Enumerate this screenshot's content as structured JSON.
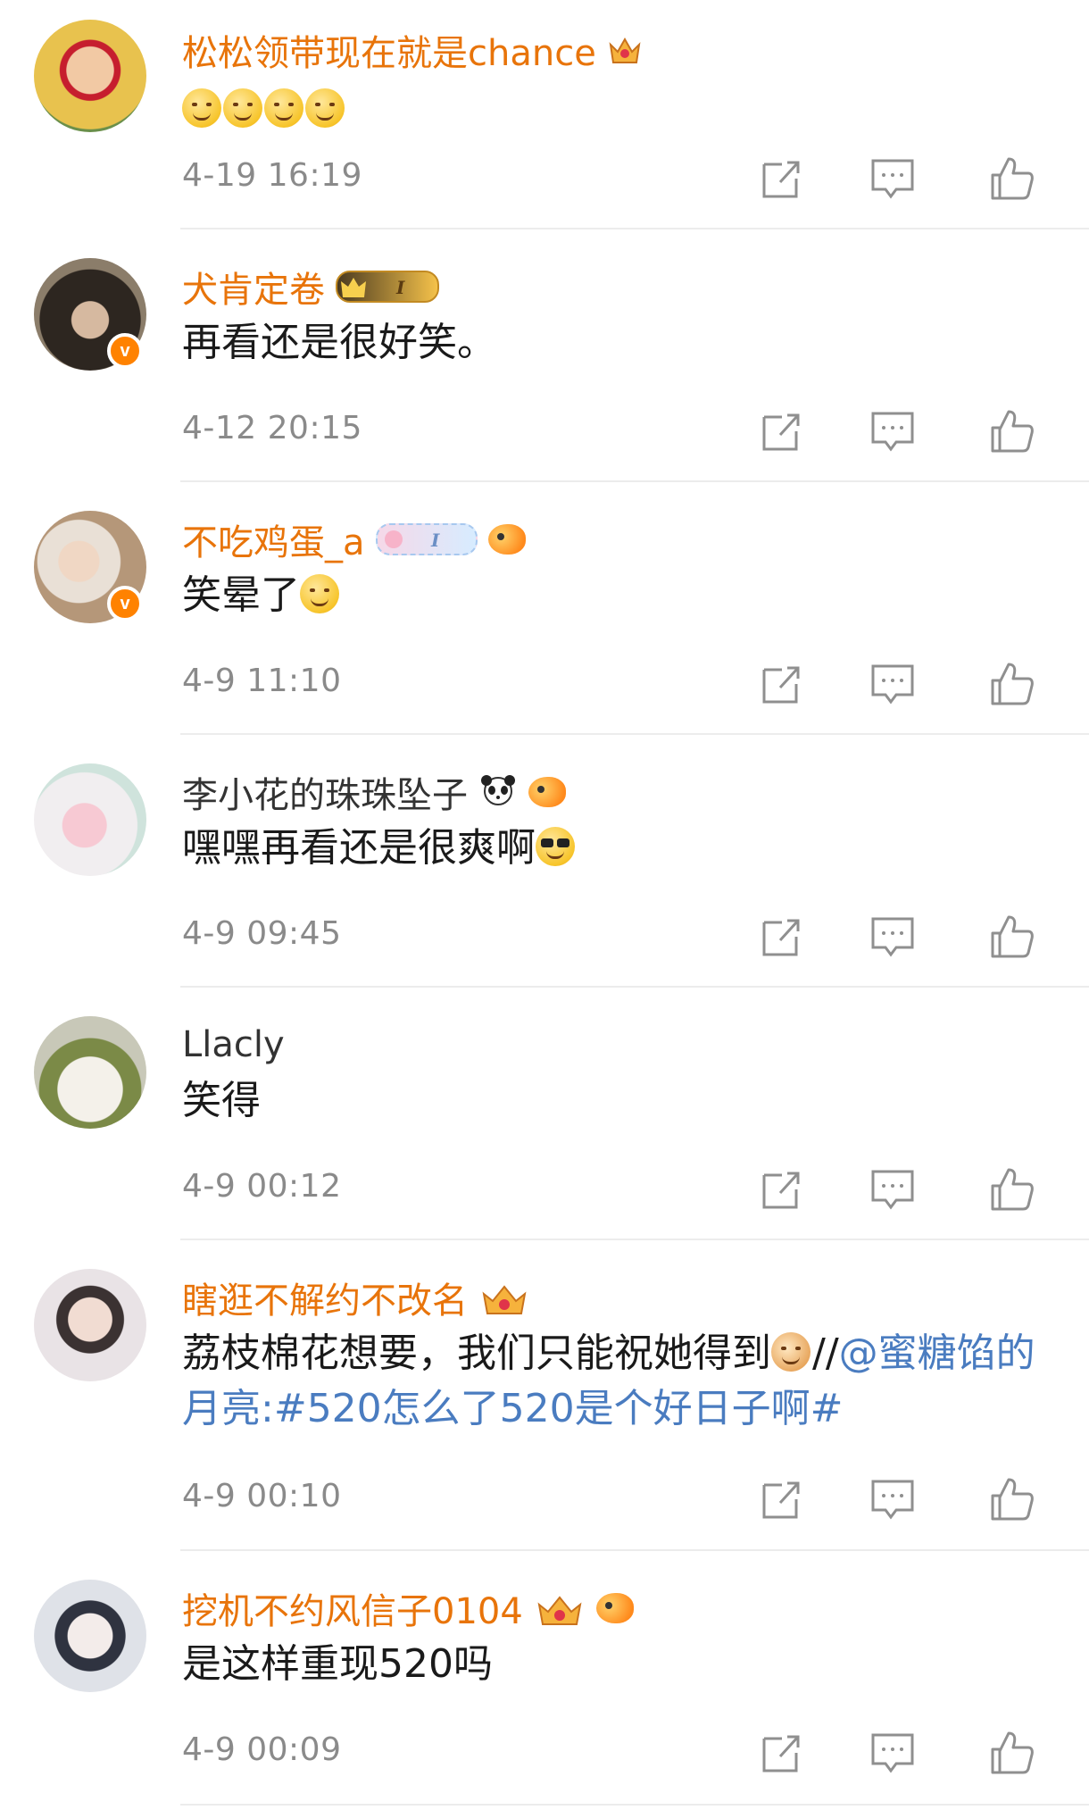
{
  "comments": [
    {
      "name": "松松领带现在就是chance",
      "name_style": "vip",
      "text": "",
      "emoji_count": 4,
      "time": "4-19 16:19",
      "avatar_color": "#d9b24a"
    },
    {
      "name": "犬肯定卷",
      "name_style": "vip",
      "text": "再看还是很好笑。",
      "time": "4-12 20:15",
      "avatar_color": "#3a332c",
      "verified": true
    },
    {
      "name": "不吃鸡蛋_a",
      "name_style": "vip",
      "text": "笑晕了",
      "time": "4-9 11:10",
      "avatar_color": "#c9b29a",
      "verified": true
    },
    {
      "name": "李小花的珠珠坠子",
      "name_style": "plain",
      "text": "嘿嘿再看还是很爽啊",
      "time": "4-9 09:45",
      "avatar_color": "#e7a6b2"
    },
    {
      "name": "Llacly",
      "name_style": "plain",
      "text": "笑得",
      "time": "4-9 00:12",
      "avatar_color": "#7d8a4a"
    },
    {
      "name": "瞎逛不解约不改名",
      "name_style": "vip",
      "text_main": "荔枝棉花想要，我们只能祝她得到",
      "text_sep": "//",
      "text_link": "@蜜糖馅的月亮:#520怎么了520是个好日子啊#",
      "time": "4-9 00:10",
      "avatar_color": "#d8c6c0"
    },
    {
      "name": "挖机不约风信子0104",
      "name_style": "vip",
      "text": "是这样重现520吗",
      "time": "4-9 00:09",
      "avatar_color": "#b7bac2"
    }
  ],
  "icons": {
    "share": "share-icon",
    "comment": "comment-icon",
    "like": "like-icon"
  },
  "colors": {
    "vip_name": "#e8740a",
    "plain_name": "#333333",
    "link": "#4a7cc0",
    "time": "#8a8a8a",
    "icon": "#8f8f8f",
    "divider": "#ececec"
  }
}
